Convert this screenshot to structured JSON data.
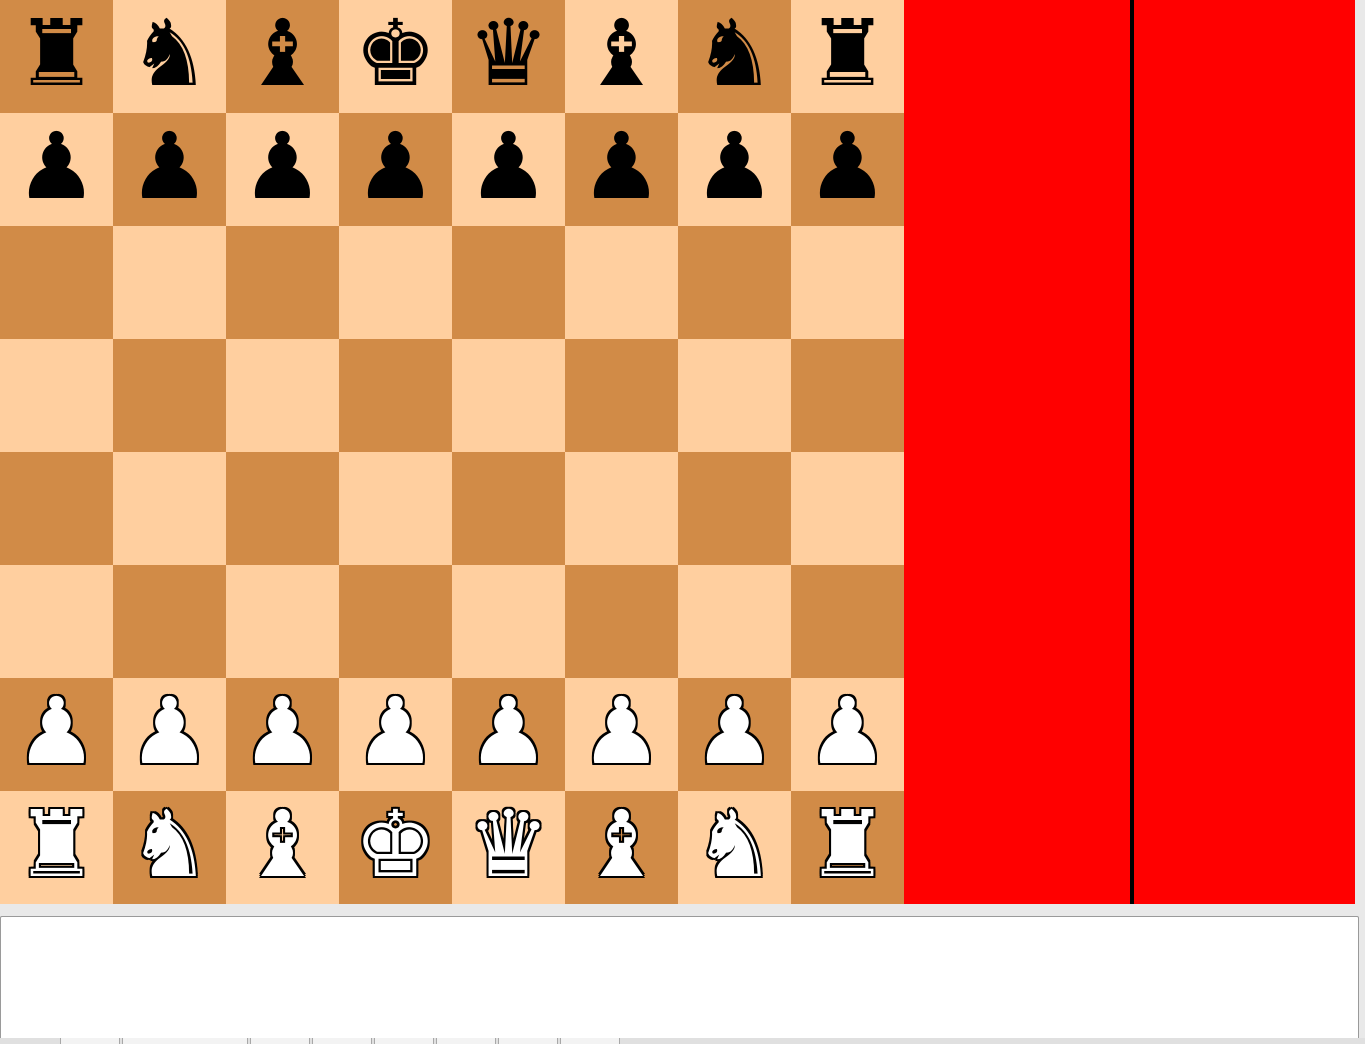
{
  "board": {
    "light_color": "#FFCF9F",
    "dark_color": "#D18B47",
    "ranks": [
      [
        "b-rook",
        "b-knight",
        "b-bishop",
        "b-king",
        "b-queen",
        "b-bishop",
        "b-knight",
        "b-rook"
      ],
      [
        "b-pawn",
        "b-pawn",
        "b-pawn",
        "b-pawn",
        "b-pawn",
        "b-pawn",
        "b-pawn",
        "b-pawn"
      ],
      [
        "",
        "",
        "",
        "",
        "",
        "",
        "",
        ""
      ],
      [
        "",
        "",
        "",
        "",
        "",
        "",
        "",
        ""
      ],
      [
        "",
        "",
        "",
        "",
        "",
        "",
        "",
        ""
      ],
      [
        "",
        "",
        "",
        "",
        "",
        "",
        "",
        ""
      ],
      [
        "w-pawn",
        "w-pawn",
        "w-pawn",
        "w-pawn",
        "w-pawn",
        "w-pawn",
        "w-pawn",
        "w-pawn"
      ],
      [
        "w-rook",
        "w-knight",
        "w-bishop",
        "w-king",
        "w-queen",
        "w-bishop",
        "w-knight",
        "w-rook"
      ]
    ]
  },
  "side_panel": {
    "background": "#FF0000",
    "divider_color": "#000000"
  },
  "log": {
    "text": ""
  },
  "bottom_tabs": [
    "",
    "",
    "",
    "",
    "",
    "",
    "",
    ""
  ]
}
